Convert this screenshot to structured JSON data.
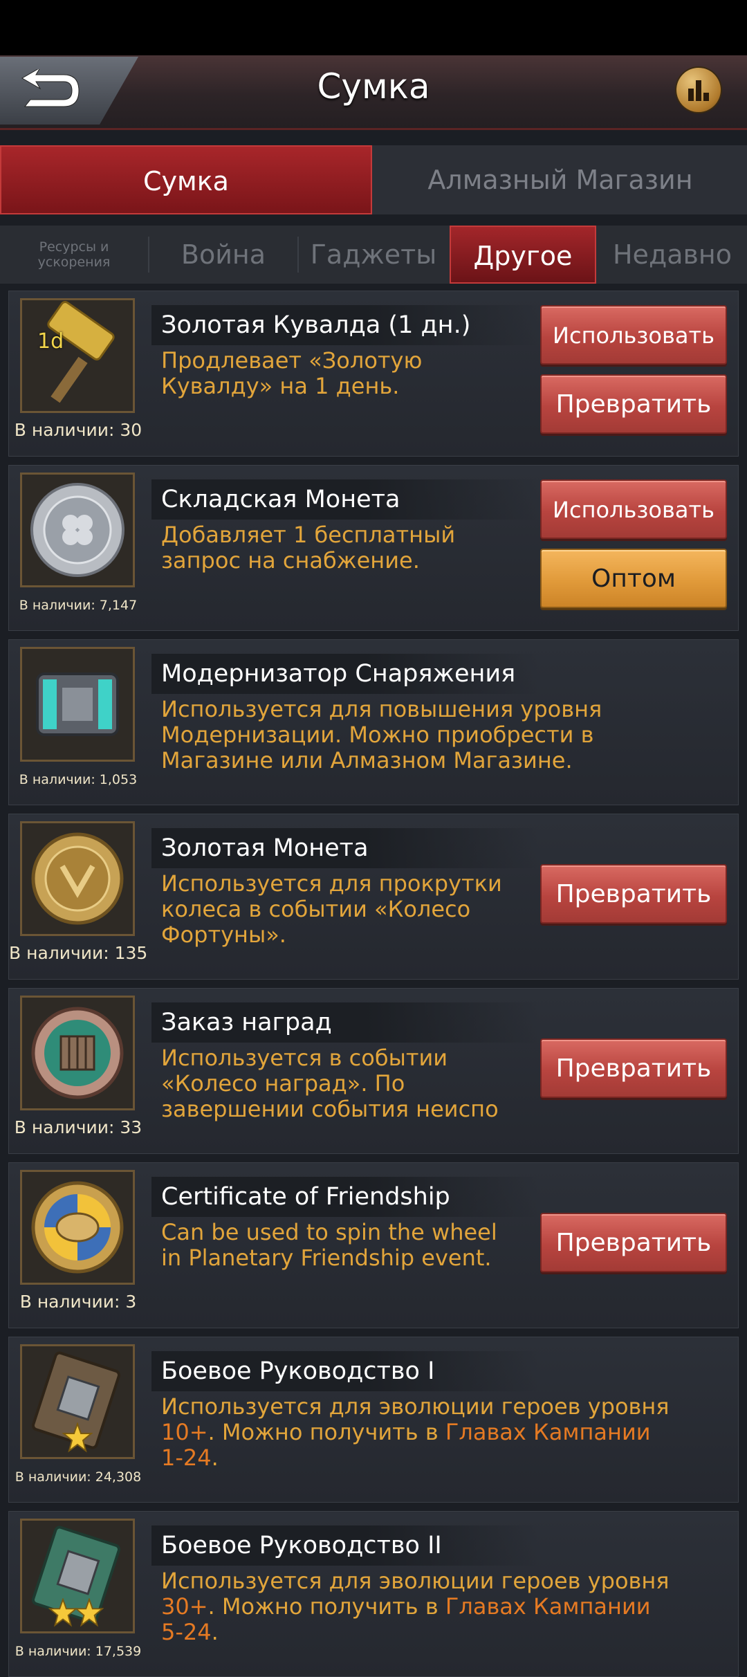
{
  "header": {
    "title": "Сумка"
  },
  "top_tabs": [
    {
      "label": "Сумка",
      "active": true
    },
    {
      "label": "Алмазный Магазин",
      "active": false
    }
  ],
  "sub_tabs": [
    {
      "label": "Ресурсы и\nускорения"
    },
    {
      "label": "Война"
    },
    {
      "label": "Гаджеты"
    },
    {
      "label": "Другое",
      "active": true
    },
    {
      "label": "Недавно"
    }
  ],
  "buttons": {
    "use": "Использовать",
    "convert": "Превратить",
    "bulk": "Оптом"
  },
  "items": [
    {
      "icon": "golden-hammer-icon",
      "badge": "1d",
      "name": "Золотая Кувалда (1 дн.)",
      "desc": "Продлевает «Золотую\nКувалду» на 1 день.",
      "count": "В наличии: 30"
    },
    {
      "icon": "silver-coin-icon",
      "name": "Складская Монета",
      "desc": "Добавляет 1 бесплатный\nзапрос на снабжение.",
      "count": "В наличии: 7,147"
    },
    {
      "icon": "gear-upgrader-icon",
      "name": "Модернизатор Снаряжения",
      "desc": "Используется для повышения уровня\nМодернизации. Можно приобрести в\nМагазине или Алмазном Магазине.",
      "count": "В наличии: 1,053"
    },
    {
      "icon": "gold-coin-icon",
      "name": "Золотая Монета",
      "desc": "Используется для прокрутки\nколеса в событии «Колесо\nФортуны».",
      "count": "В наличии: 135"
    },
    {
      "icon": "reward-order-icon",
      "name": "Заказ наград",
      "desc": "Используется в событии\n«Колесо наград». По\nзавершении события неиспо",
      "count": "В наличии: 33"
    },
    {
      "icon": "friendship-certificate-icon",
      "name": "Certificate of Friendship",
      "desc": "Can be used to spin the wheel\nin Planetary Friendship event.",
      "count": "В наличии: 3"
    },
    {
      "icon": "battle-manual-icon",
      "name": "Боевое Руководство I",
      "desc_parts": [
        "Используется для эволюции героев уровня",
        "10+",
        ". Можно получить в ",
        "Главах Кампании",
        "1-24",
        "."
      ],
      "count": "В наличии: 24,308"
    },
    {
      "icon": "battle-manual-icon",
      "name": "Боевое Руководство II",
      "desc_parts": [
        "Используется для эволюции героев уровня",
        "30+",
        ". Можно получить в ",
        "Главах Кампании",
        "5-24",
        "."
      ],
      "count": "В наличии: 17,539"
    }
  ],
  "colors": {
    "accent_red": "#a8262a",
    "desc_orange": "#e2a53b",
    "highlight_orange": "#e57a23",
    "bulk_orange": "#e19a3a"
  }
}
